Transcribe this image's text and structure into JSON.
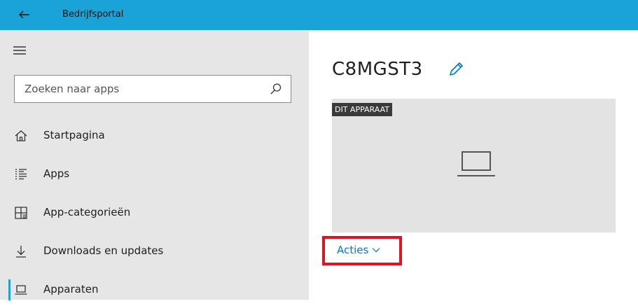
{
  "app": {
    "title": "Bedrijfsportal"
  },
  "search": {
    "placeholder": "Zoeken naar apps"
  },
  "sidebar": {
    "items": [
      {
        "label": "Startpagina",
        "icon": "home-icon"
      },
      {
        "label": "Apps",
        "icon": "apps-list-icon"
      },
      {
        "label": "App-categorieën",
        "icon": "categories-icon"
      },
      {
        "label": "Downloads en updates",
        "icon": "download-icon"
      },
      {
        "label": "Apparaten",
        "icon": "devices-icon",
        "selected": true
      }
    ]
  },
  "device": {
    "name": "C8MGST3",
    "badge": "DIT APPARAAT",
    "icon": "laptop-icon"
  },
  "actions": {
    "label": "Acties"
  },
  "colors": {
    "accent": "#1aa3d6",
    "link": "#0078d7",
    "highlight": "#e0141e",
    "sidebar_bg": "#e6e6e6",
    "tile_bg": "#e3e3e3"
  }
}
